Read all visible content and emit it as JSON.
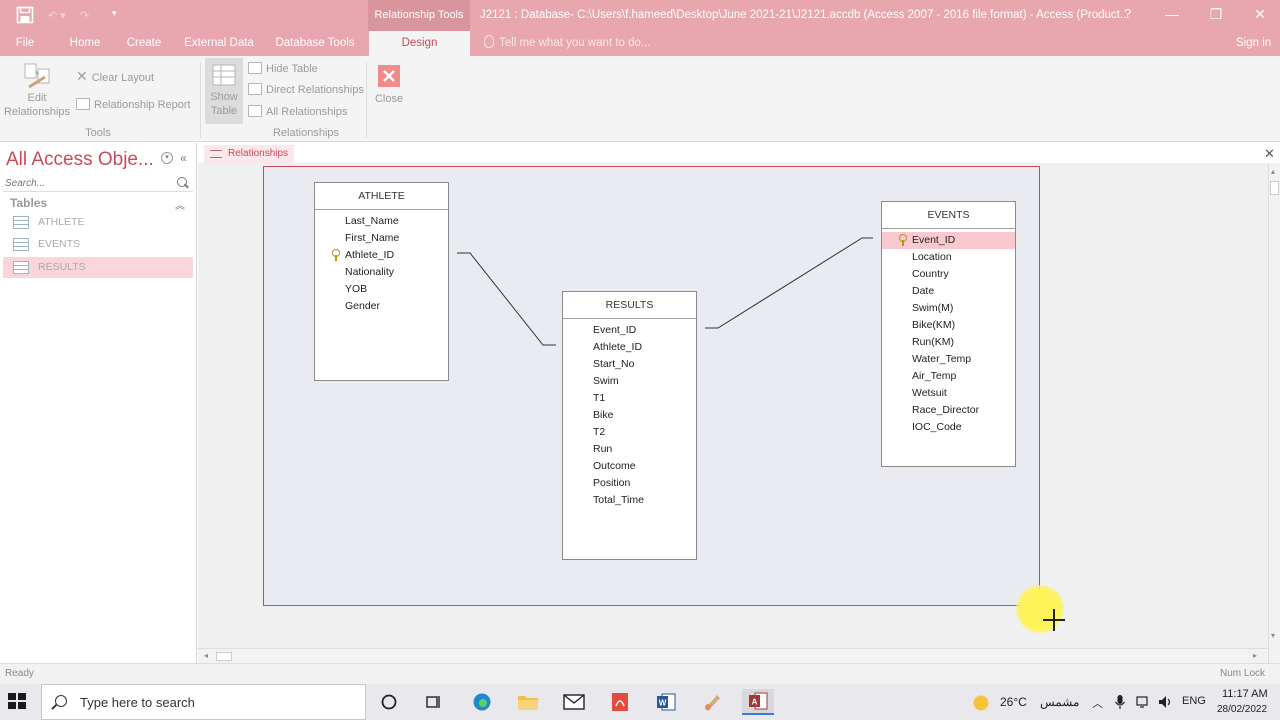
{
  "window": {
    "context_title": "Relationship Tools",
    "title": "J2121 : Database- C:\\Users\\f.hameed\\Desktop\\June 2021-21\\J2121.accdb (Access 2007 - 2016 file format) - Access (Product...",
    "help": "?",
    "minimize": "—",
    "restore": "❐",
    "close": "✕",
    "accent_color": "#e8a6ae"
  },
  "tabs": [
    "File",
    "Home",
    "Create",
    "External Data",
    "Database Tools",
    "Design"
  ],
  "active_tab": "Design",
  "tell_me": "Tell me what you want to do...",
  "sign_in": "Sign in",
  "ribbon": {
    "edit_relationships": "Edit Relationships",
    "clear_layout": "Clear Layout",
    "relationship_report": "Relationship Report",
    "tools_group": "Tools",
    "show_table": "Show Table",
    "hide_table": "Hide Table",
    "direct_relationships": "Direct Relationships",
    "all_relationships": "All Relationships",
    "relationships_group": "Relationships",
    "close": "Close"
  },
  "nav": {
    "title": "All Access Obje...",
    "search_placeholder": "Search...",
    "section": "Tables",
    "items": [
      "ATHLETE",
      "EVENTS",
      "RESULTS"
    ],
    "selected": "RESULTS"
  },
  "document_tab": "Relationships",
  "tables": {
    "athlete": {
      "name": "ATHLETE",
      "fields": [
        "Last_Name",
        "First_Name",
        "Athlete_ID",
        "Nationality",
        "YOB",
        "Gender"
      ],
      "key": "Athlete_ID"
    },
    "results": {
      "name": "RESULTS",
      "fields": [
        "Event_ID",
        "Athlete_ID",
        "Start_No",
        "Swim",
        "T1",
        "Bike",
        "T2",
        "Run",
        "Outcome",
        "Position",
        "Total_Time"
      ]
    },
    "events": {
      "name": "EVENTS",
      "fields": [
        "Event_ID",
        "Location",
        "Country",
        "Date",
        "Swim(M)",
        "Bike(KM)",
        "Run(KM)",
        "Water_Temp",
        "Air_Temp",
        "Wetsuit",
        "Race_Director",
        "IOC_Code"
      ],
      "key": "Event_ID",
      "highlighted": "Event_ID"
    }
  },
  "status": {
    "left": "Ready",
    "right": "Num Lock"
  },
  "taskbar": {
    "search": "Type here to search",
    "weather": "26°C",
    "weather_text": "مشمس",
    "language": "ENG",
    "time": "11:17 AM",
    "date": "28/02/2022"
  }
}
